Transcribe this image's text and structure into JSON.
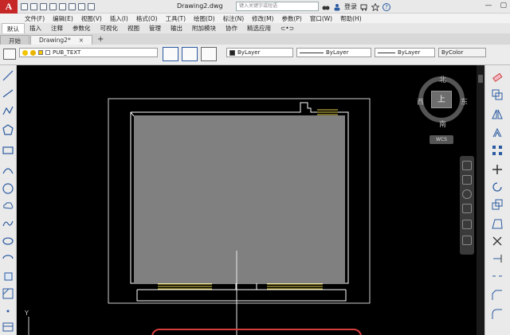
{
  "app": {
    "logo_letter": "A",
    "document_title": "Drawing2.dwg",
    "search_placeholder": "键入关键字或短语",
    "login_label": "登录",
    "help_label": "?"
  },
  "menu": [
    "文件(F)",
    "编辑(E)",
    "视图(V)",
    "插入(I)",
    "格式(O)",
    "工具(T)",
    "绘图(D)",
    "标注(N)",
    "修改(M)",
    "参数(P)",
    "窗口(W)",
    "帮助(H)"
  ],
  "ribbon_tabs": [
    "默认",
    "插入",
    "注释",
    "参数化",
    "可视化",
    "视图",
    "管理",
    "输出",
    "附加模块",
    "协作",
    "精选应用",
    "⊂•⊃"
  ],
  "document_tabs": [
    {
      "label": "开始",
      "active": false
    },
    {
      "label": "Drawing2*",
      "active": true
    }
  ],
  "new_tab_label": "+",
  "close_label": "×",
  "layer": {
    "current": "PUB_TEXT"
  },
  "properties": {
    "color": "ByLayer",
    "linetype": "ByLayer",
    "lineweight": "ByLayer",
    "plot_style": "ByColor"
  },
  "viewcube": {
    "north": "北",
    "south": "南",
    "east": "东",
    "west": "西",
    "face": "上",
    "wcs": "WCS"
  },
  "ucs_label": "Y",
  "colors": {
    "canvas": "#000000",
    "fill": "#808080",
    "wall_line": "#ffffff",
    "window_line": "#e6d34a",
    "highlight": "#d43b3b",
    "logo": "#c62828"
  },
  "icons": [
    "new-icon",
    "open-icon",
    "save-icon",
    "saveas-icon",
    "print-icon",
    "undo-icon",
    "redo-icon",
    "share-icon",
    "binoculars-icon",
    "login-icon",
    "cart-icon",
    "star-icon",
    "help-icon"
  ]
}
